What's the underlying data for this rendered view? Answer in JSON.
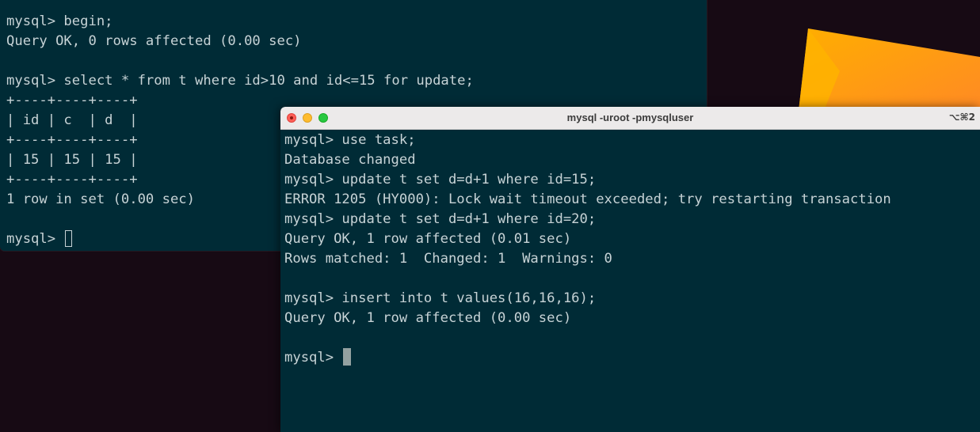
{
  "back_terminal": {
    "lines": [
      "mysql> begin;",
      "Query OK, 0 rows affected (0.00 sec)",
      "",
      "mysql> select * from t where id>10 and id<=15 for update;",
      "+----+----+----+",
      "| id | c  | d  |",
      "+----+----+----+",
      "| 15 | 15 | 15 |",
      "+----+----+----+",
      "1 row in set (0.00 sec)",
      ""
    ],
    "prompt": "mysql> "
  },
  "front_terminal": {
    "title": "mysql -uroot -pmysqluser",
    "shortcut": "⌥⌘2",
    "lines": [
      "mysql> use task;",
      "Database changed",
      "mysql> update t set d=d+1 where id=15;",
      "ERROR 1205 (HY000): Lock wait timeout exceeded; try restarting transaction",
      "mysql> update t set d=d+1 where id=20;",
      "Query OK, 1 row affected (0.01 sec)",
      "Rows matched: 1  Changed: 1  Warnings: 0",
      "",
      "mysql> insert into t values(16,16,16);",
      "Query OK, 1 row affected (0.00 sec)",
      ""
    ],
    "prompt": "mysql> "
  },
  "colors": {
    "terminal_bg": "#002b36",
    "terminal_text": "#c7d3d6",
    "desktop_bg": "#170a14",
    "wallpaper_orange": "#ff9a1f"
  }
}
